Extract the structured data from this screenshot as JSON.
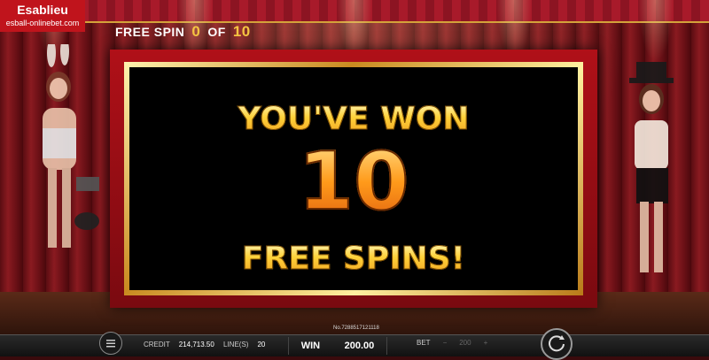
{
  "logo": {
    "main": "Esablieu",
    "sub": "esball-onlinebet.com"
  },
  "free_spin": {
    "label": "FREE SPIN",
    "current": "0",
    "of_label": "OF",
    "total": "10"
  },
  "popup": {
    "line1": "YOU'VE WON",
    "line2": "10",
    "line3": "FREE SPINS!"
  },
  "bottom": {
    "ticket": "No.7288517121118",
    "credit_label": "CREDIT",
    "credit_value": "214,713.50",
    "lines_label": "LINE(S)",
    "lines_value": "20",
    "win_label": "WIN",
    "win_value": "200.00",
    "bet_label": "BET",
    "bet_value": "200"
  },
  "colors": {
    "accent_gold": "#f5c542",
    "curtain_red": "#8a1a20",
    "frame_red": "#b01018"
  }
}
